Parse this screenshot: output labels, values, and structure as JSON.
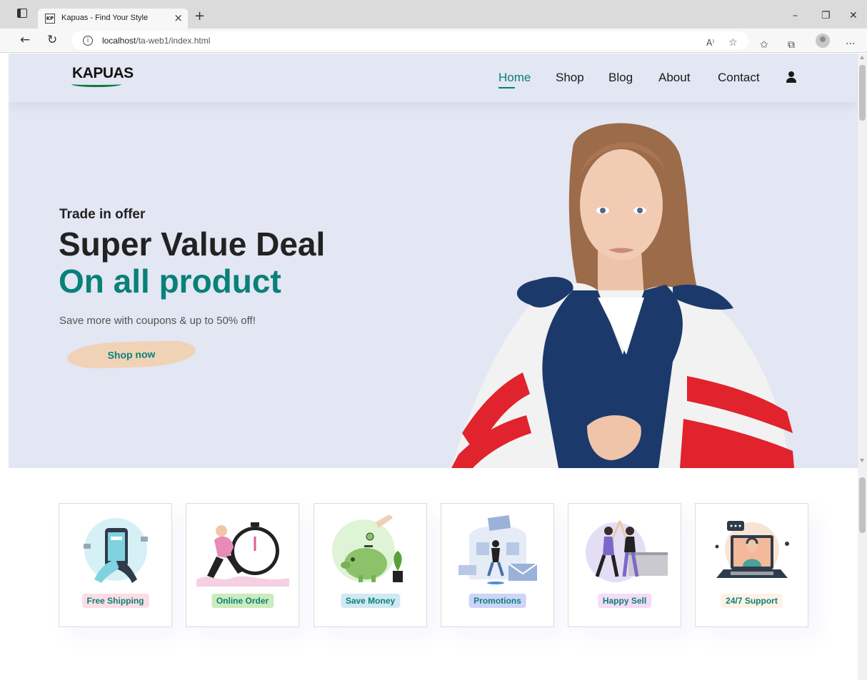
{
  "browser": {
    "tab_title": "Kapuas - Find Your Style",
    "favicon_text": "KP",
    "url_host": "localhost",
    "url_path": "/ta-web1/index.html",
    "icons": [
      "window-menu-icon",
      "close-tab-icon",
      "new-tab-icon",
      "minimize-icon",
      "restore-icon",
      "close-window-icon",
      "back-icon",
      "refresh-icon",
      "site-info-icon",
      "read-aloud-icon",
      "add-favorite-icon",
      "favorites-icon",
      "collections-icon",
      "profile-icon",
      "more-icon"
    ]
  },
  "site": {
    "logo": "KAPUAS",
    "nav": [
      "Home",
      "Shop",
      "Blog",
      "About",
      "Contact"
    ],
    "active_nav": "Home",
    "accent_color": "#088178",
    "hero_bg_color": "#e3e6f3"
  },
  "hero": {
    "subtitle": "Trade in offer",
    "headline": "Super Value Deal",
    "headline_accent": "On all product",
    "text": "Save more with coupons & up to 50% off!",
    "button": "Shop now"
  },
  "features": [
    {
      "label": "Free Shipping",
      "color": "#fddde4"
    },
    {
      "label": "Online Order",
      "color": "#cdebbc"
    },
    {
      "label": "Save Money",
      "color": "#d1e8f2"
    },
    {
      "label": "Promotions",
      "color": "#cdd4f8"
    },
    {
      "label": "Happy Sell",
      "color": "#f6dbf6"
    },
    {
      "label": "24/7 Support",
      "color": "#fff2e5"
    }
  ]
}
